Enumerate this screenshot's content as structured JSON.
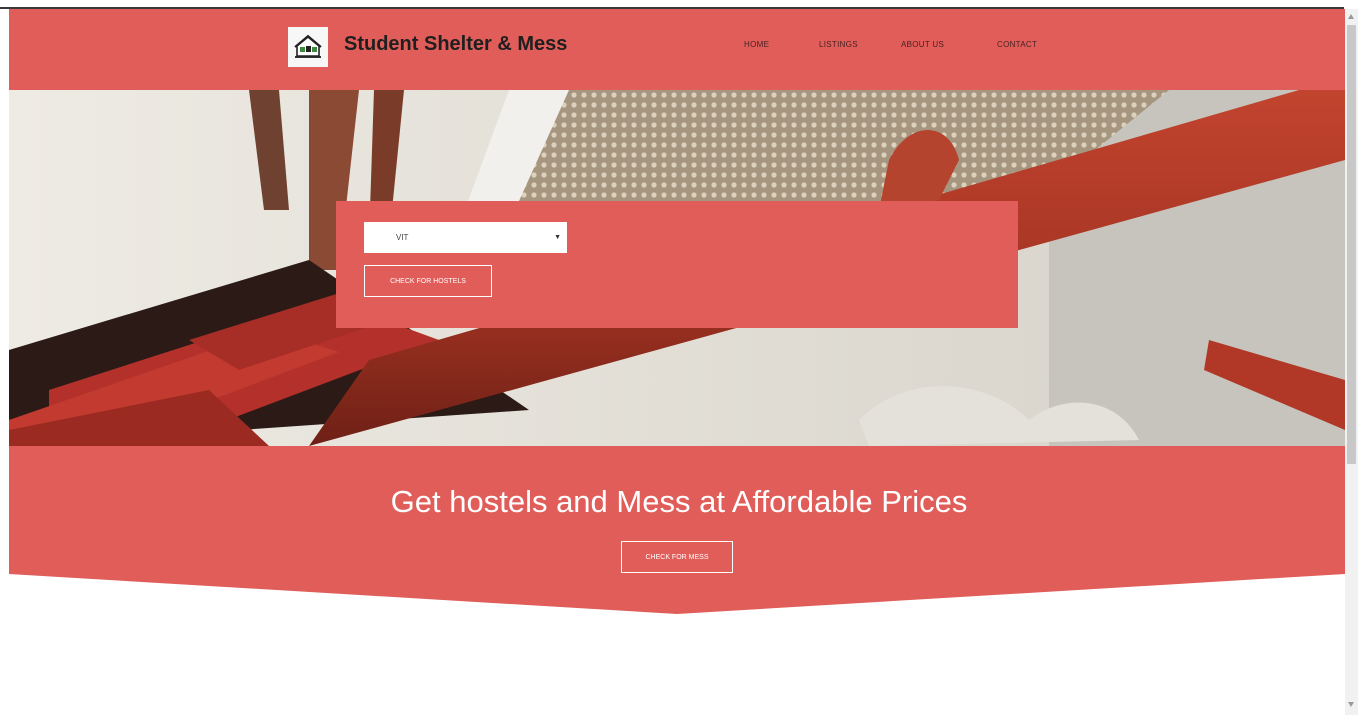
{
  "header": {
    "brand": "Student Shelter & Mess",
    "nav": [
      "HOME",
      "LISTINGS",
      "ABOUT US",
      "CONTACT"
    ]
  },
  "search": {
    "selected": "VIT",
    "check_hostels": "CHECK FOR HOSTELS"
  },
  "promo": {
    "tagline": "Get hostels and Mess at Affordable Prices",
    "check_mess": "CHECK FOR MESS"
  },
  "icons": [
    "house-logo-icon",
    "chevron-down-icon"
  ],
  "colors": {
    "accent": "#e05d5a",
    "text_dark": "#1f1f1f",
    "white": "#ffffff"
  }
}
